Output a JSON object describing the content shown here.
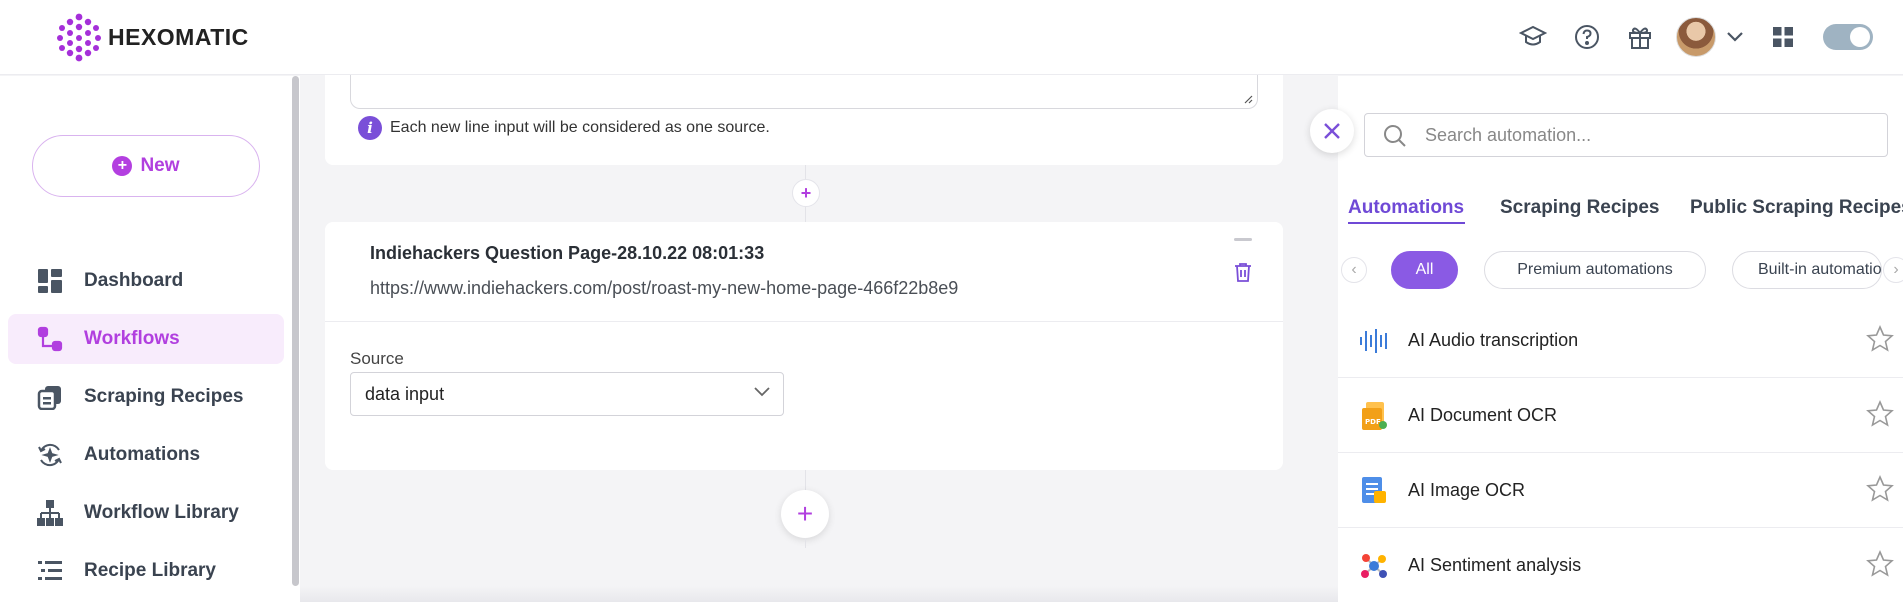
{
  "app": {
    "brand": "HEXOMATIC"
  },
  "header": {
    "icons": [
      "academy-icon",
      "help-icon",
      "gift-icon",
      "avatar",
      "chevron-down-icon",
      "apps-grid-icon",
      "theme-toggle"
    ]
  },
  "sidebar": {
    "new_label": "New",
    "items": [
      {
        "label": "Dashboard",
        "icon": "dashboard-icon",
        "active": false
      },
      {
        "label": "Workflows",
        "icon": "workflows-icon",
        "active": true
      },
      {
        "label": "Scraping Recipes",
        "icon": "scraping-recipes-icon",
        "active": false
      },
      {
        "label": "Automations",
        "icon": "automations-icon",
        "active": false
      },
      {
        "label": "Workflow Library",
        "icon": "workflow-library-icon",
        "active": false
      },
      {
        "label": "Recipe Library",
        "icon": "recipe-library-icon",
        "active": false
      }
    ]
  },
  "main": {
    "hint": "Each new line input will be considered as one source.",
    "step": {
      "title": "Indiehackers Question Page-28.10.22 08:01:33",
      "url": "https://www.indiehackers.com/post/roast-my-new-home-page-466f22b8e9"
    },
    "source": {
      "label": "Source",
      "value": "data input"
    }
  },
  "panel": {
    "search_placeholder": "Search automation...",
    "tabs": [
      "Automations",
      "Scraping Recipes",
      "Public Scraping Recipes"
    ],
    "active_tab": "Automations",
    "chips": [
      "All",
      "Premium automations",
      "Built-in automations"
    ],
    "active_chip": "All",
    "automations": [
      {
        "name": "AI Audio transcription",
        "icon": "audio-waveform-icon"
      },
      {
        "name": "AI Document OCR",
        "icon": "pdf-document-icon"
      },
      {
        "name": "AI Image OCR",
        "icon": "image-document-icon"
      },
      {
        "name": "AI Sentiment analysis",
        "icon": "sentiment-nodes-icon"
      }
    ]
  },
  "colors": {
    "brand_purple": "#b13fdf",
    "accent_violet": "#6f49d6",
    "active_chip": "#8a5ae4"
  }
}
